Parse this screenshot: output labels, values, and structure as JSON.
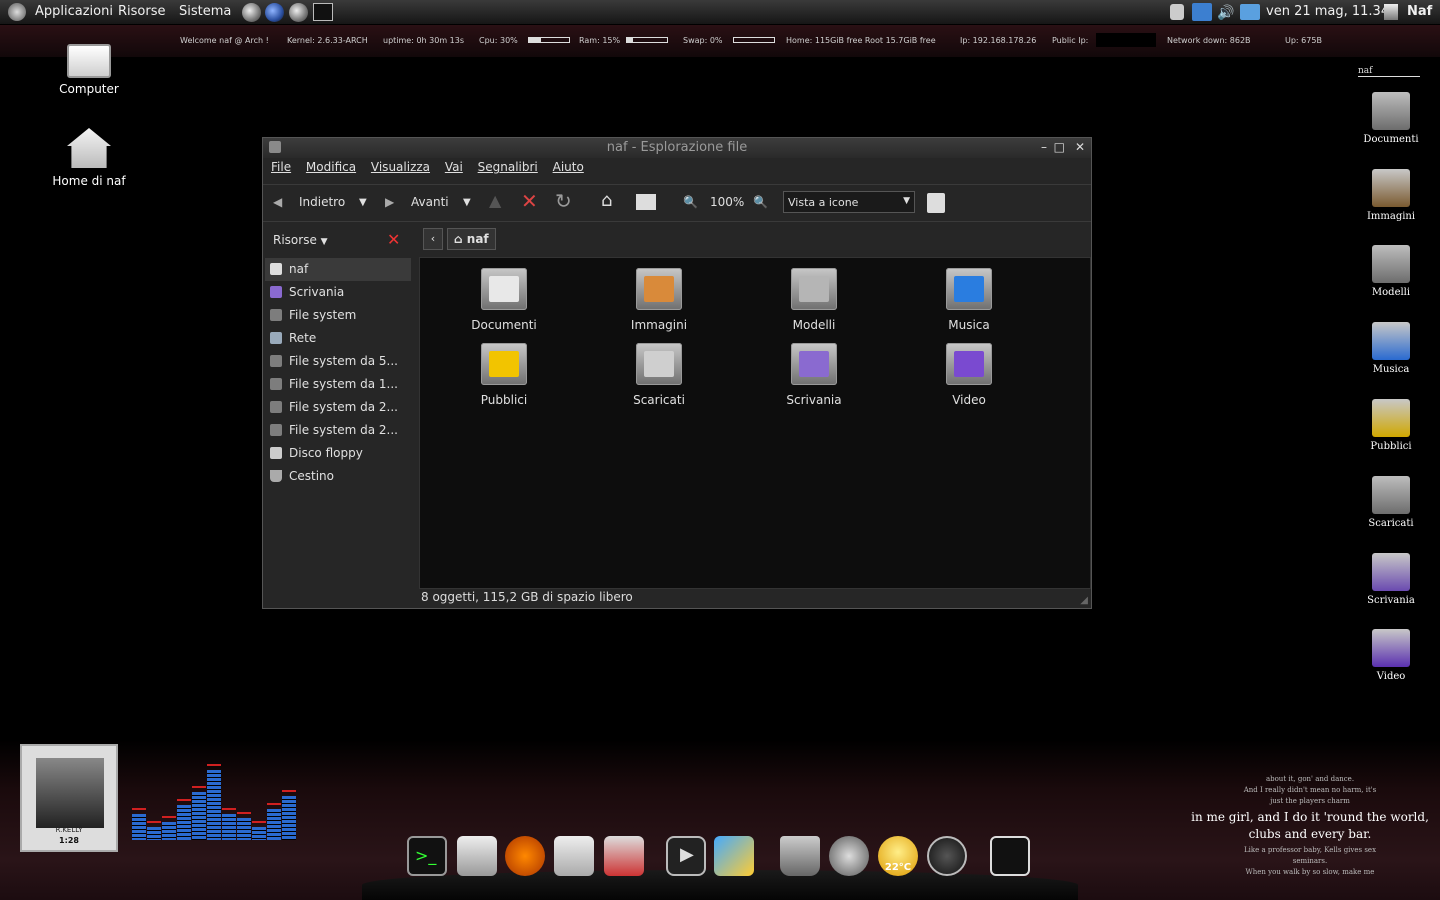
{
  "panel": {
    "menus": [
      "Applicazioni",
      "Risorse",
      "Sistema"
    ],
    "datetime": "ven 21 mag, 11.34",
    "user": "Naf"
  },
  "conky": {
    "welcome": "Welcome naf @ Arch !",
    "kernel": "Kernel: 2.6.33-ARCH",
    "uptime": "uptime: 0h 30m 13s",
    "cpu": "Cpu: 30%",
    "cpu_fraction": 0.3,
    "ram": "Ram: 15%",
    "ram_fraction": 0.15,
    "swap": "Swap: 0%",
    "swap_fraction": 0,
    "disk": "Home: 115GiB free Root 15.7GiB free",
    "ip": "Ip: 192.168.178.26",
    "public_ip": "Public Ip:",
    "network": "Network down: 862B",
    "up": "Up: 675B",
    "user_label": "naf"
  },
  "desktop_left": [
    {
      "label": "Computer",
      "icon": "computer-icon"
    },
    {
      "label": "Home di naf",
      "icon": "home-icon"
    }
  ],
  "desktop_right": [
    {
      "label": "Documenti"
    },
    {
      "label": "Immagini"
    },
    {
      "label": "Modelli"
    },
    {
      "label": "Musica"
    },
    {
      "label": "Pubblici"
    },
    {
      "label": "Scaricati"
    },
    {
      "label": "Scrivania"
    },
    {
      "label": "Video"
    }
  ],
  "window": {
    "title": "naf - Esplorazione file",
    "menu": [
      "File",
      "Modifica",
      "Visualizza",
      "Vai",
      "Segnalibri",
      "Aiuto"
    ],
    "toolbar": {
      "back": "Indietro",
      "forward": "Avanti",
      "zoom": "100%",
      "view_mode": "Vista a icone"
    },
    "sidebar": {
      "header": "Risorse",
      "places": [
        "naf",
        "Scrivania",
        "File system",
        "Rete",
        "File system da 5...",
        "File system da 1...",
        "File system da 2...",
        "File system da 2...",
        "Disco floppy",
        "Cestino"
      ]
    },
    "path": "naf",
    "items": [
      {
        "label": "Documenti",
        "accent": "#e8e8e8"
      },
      {
        "label": "Immagini",
        "accent": "#d98a3a"
      },
      {
        "label": "Modelli",
        "accent": "#b5b5b5"
      },
      {
        "label": "Musica",
        "accent": "#2a7de0"
      },
      {
        "label": "Pubblici",
        "accent": "#f2c400"
      },
      {
        "label": "Scaricati",
        "accent": "#cfcfcf"
      },
      {
        "label": "Scrivania",
        "accent": "#8a6ad0"
      },
      {
        "label": "Video",
        "accent": "#7a4ad0"
      }
    ],
    "status": "8 oggetti, 115,2 GB di spazio libero"
  },
  "bottom": {
    "album_caption": "R.KELLY",
    "album_time": "1:28",
    "weather": "22°C",
    "equalizer_levels": [
      0.3,
      0.15,
      0.2,
      0.4,
      0.55,
      0.8,
      0.3,
      0.25,
      0.15,
      0.35,
      0.5
    ],
    "lyrics_small_top": [
      "about it, gon' and dance.",
      "And I really didn't mean no harm, it's",
      "just the players charm"
    ],
    "lyrics_main": [
      "in me girl, and I do it 'round the world,",
      "clubs and every bar."
    ],
    "lyrics_small_bottom": [
      "Like a professor baby, Kells gives sex",
      "seminars.",
      "When you walk by so slow, make me"
    ]
  }
}
